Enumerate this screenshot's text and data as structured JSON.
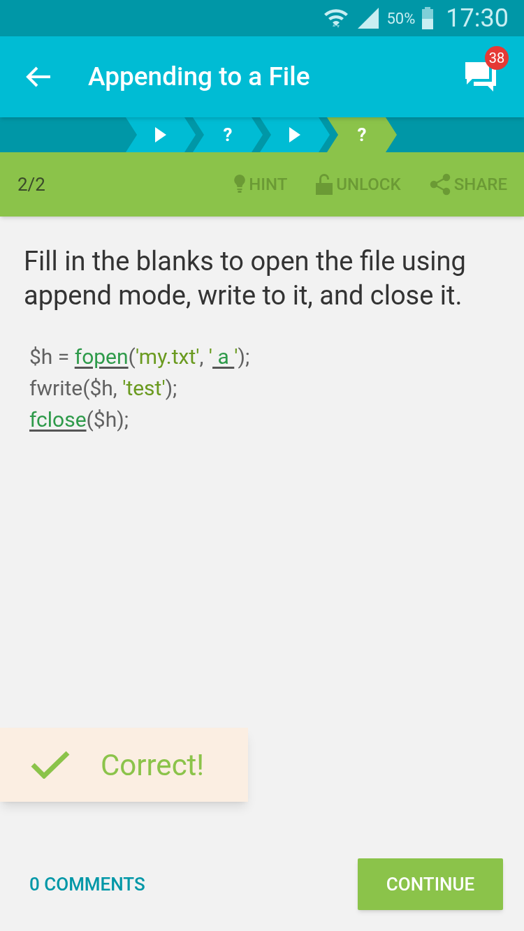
{
  "status_bar": {
    "battery": "50%",
    "time": "17:30"
  },
  "app_bar": {
    "title": "Appending to a File",
    "badge": "38"
  },
  "steps": [
    {
      "kind": "lesson",
      "selected": false
    },
    {
      "kind": "quiz",
      "label": "?",
      "selected": false
    },
    {
      "kind": "lesson",
      "selected": false
    },
    {
      "kind": "quiz",
      "label": "?",
      "selected": true
    }
  ],
  "toolbar": {
    "counter": "2/2",
    "actions": [
      {
        "kind": "hint",
        "label": "HINT"
      },
      {
        "kind": "unlock",
        "label": "UNLOCK"
      },
      {
        "kind": "share",
        "label": "SHARE"
      }
    ]
  },
  "question": "Fill in the blanks to open the file using append mode, write to it, and close it.",
  "code_lines": [
    [
      {
        "kind": "plain",
        "text": "$h = "
      },
      {
        "kind": "blank",
        "text": "fopen"
      },
      {
        "kind": "plain",
        "text": "("
      },
      {
        "kind": "string",
        "text": "'my.txt'"
      },
      {
        "kind": "plain",
        "text": ", "
      },
      {
        "kind": "string",
        "text": "'"
      },
      {
        "kind": "blank",
        "text": " a "
      },
      {
        "kind": "string",
        "text": "'"
      },
      {
        "kind": "plain",
        "text": ");"
      }
    ],
    [
      {
        "kind": "plain",
        "text": "fwrite($h, "
      },
      {
        "kind": "string",
        "text": "'test'"
      },
      {
        "kind": "plain",
        "text": ");"
      }
    ],
    [
      {
        "kind": "blank",
        "text": "fclose"
      },
      {
        "kind": "plain",
        "text": "($h);"
      }
    ]
  ],
  "toast": {
    "text": "Correct!"
  },
  "footer": {
    "comments": "0 COMMENTS",
    "button": "CONTINUE"
  }
}
